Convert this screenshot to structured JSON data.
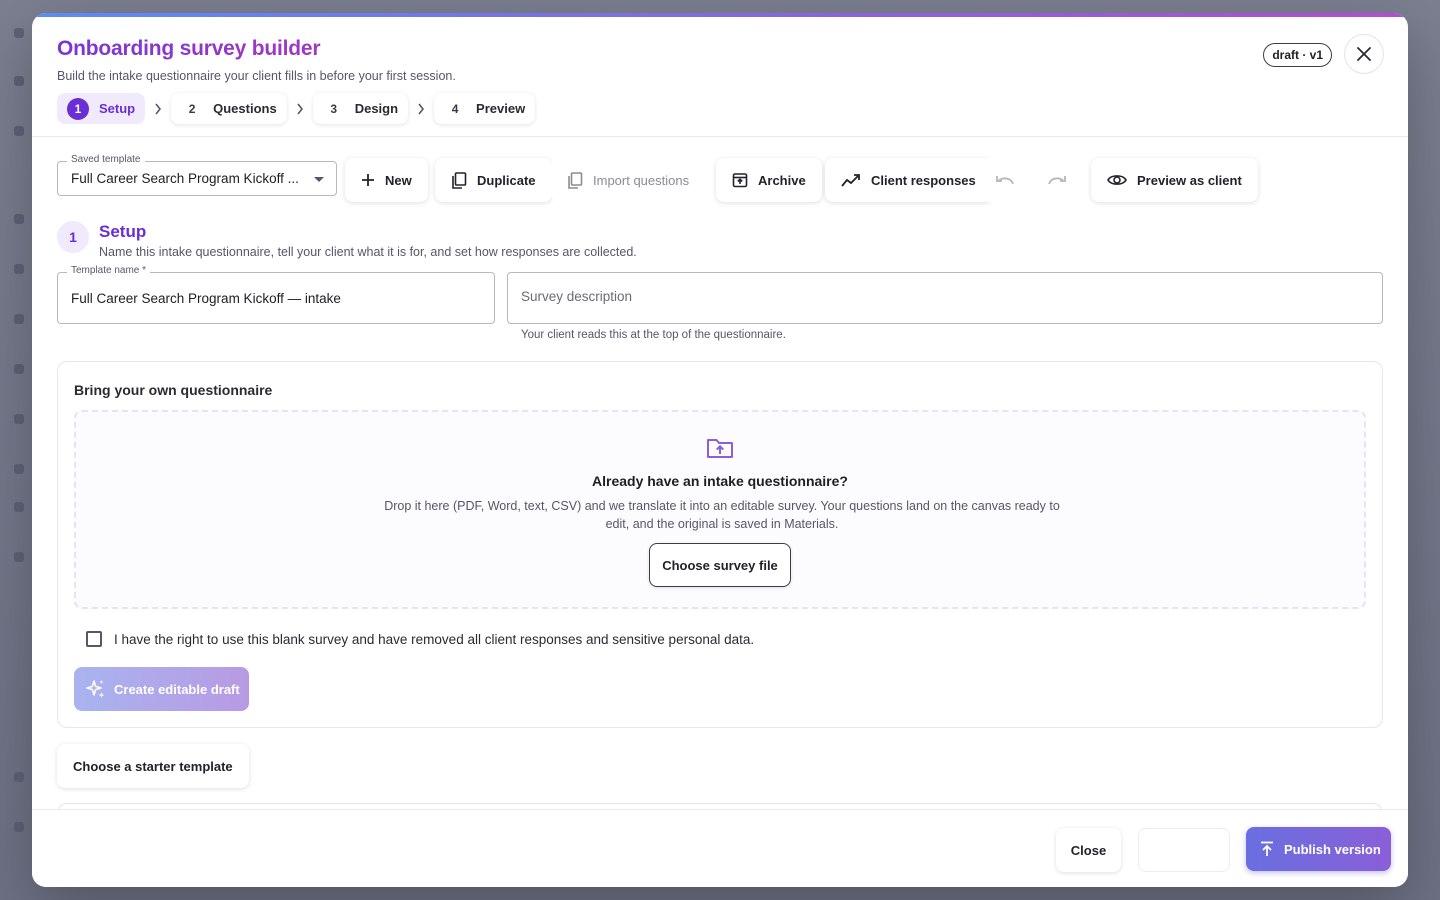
{
  "modal": {
    "title": "Onboarding survey builder",
    "subtitle": "Build the intake questionnaire your client fills in before your first session.",
    "badge": "draft · v1"
  },
  "stepper": [
    {
      "num": "1",
      "label": "Setup",
      "active": true
    },
    {
      "num": "2",
      "label": "Questions",
      "active": false
    },
    {
      "num": "3",
      "label": "Design",
      "active": false
    },
    {
      "num": "4",
      "label": "Preview",
      "active": false
    }
  ],
  "toolbar": {
    "saved_template_label": "Saved template",
    "saved_template_value": "Full Career Search Program Kickoff ...",
    "new_label": "New",
    "duplicate_label": "Duplicate",
    "import_label": "Import questions",
    "archive_label": "Archive",
    "responses_label": "Client responses",
    "preview_label": "Preview as client"
  },
  "setup": {
    "num": "1",
    "title": "Setup",
    "description": "Name this intake questionnaire, tell your client what it is for, and set how responses are collected.",
    "template_name_label": "Template name *",
    "template_name_value": "Full Career Search Program Kickoff — intake",
    "description_placeholder": "Survey description",
    "description_helper": "Your client reads this at the top of the questionnaire."
  },
  "byo": {
    "title": "Bring your own questionnaire",
    "drop_title": "Already have an intake questionnaire?",
    "drop_desc": "Drop it here (PDF, Word, text, CSV) and we translate it into an editable survey. Your questions land on the canvas ready to edit, and the original is saved in Materials.",
    "choose_label": "Choose survey file",
    "consent_text": "I have the right to use this blank survey and have removed all client responses and sensitive personal data.",
    "create_label": "Create editable draft"
  },
  "starter": {
    "label": "Choose a starter template"
  },
  "footer": {
    "close_label": "Close",
    "publish_label": "Publish version"
  },
  "colors": {
    "accent": "#6a2ed4",
    "title_gradient_start": "#7a35d6",
    "title_gradient_end": "#b43ab8",
    "publish_start": "#6a6fe0",
    "publish_end": "#8a5fd8"
  }
}
